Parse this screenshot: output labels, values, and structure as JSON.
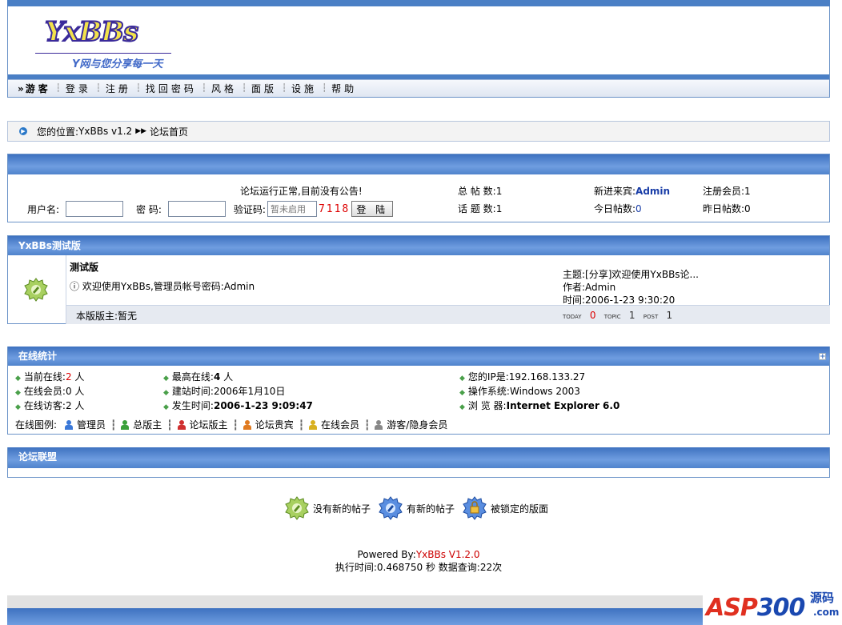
{
  "header": {
    "logo_text": "YxBBs",
    "slogan": "Y网与您分享每一天"
  },
  "nav": {
    "guest": "游客",
    "items": [
      "登录",
      "注册",
      "找回密码",
      "风格",
      "面版",
      "设施",
      "帮助"
    ]
  },
  "breadcrumb": {
    "prefix": "您的位置: ",
    "home": "YxBBs v1.2",
    "current": "论坛首页"
  },
  "login": {
    "notice": "论坛运行正常,目前没有公告!",
    "username_label": "用户名:",
    "password_label": "密 码:",
    "captcha_label": "验证码:",
    "captcha_placeholder": "暂未启用",
    "captcha_code": "7118",
    "login_button": "登 陆"
  },
  "stats": {
    "total_posts_label": "总 帖 数:",
    "total_posts": "1",
    "topics_label": "话 题 数:",
    "topics": "1",
    "newest_member_label": "新进来宾:",
    "newest_member": "Admin",
    "today_posts_label": "今日帖数:",
    "today_posts": "0",
    "registered_label": "注册会员:",
    "registered": "1",
    "yesterday_posts_label": "昨日帖数:",
    "yesterday_posts": "0"
  },
  "forum_section": {
    "title": "YxBBs测试版",
    "forum_name": "测试版",
    "description": "欢迎使用YxBBs,管理员帐号密码:Admin",
    "moderator": "本版版主:暂无",
    "last_topic": "主题:[分享]欢迎使用YxBBs论...",
    "last_author": "作者:Admin",
    "last_time": "时间:2006-1-23 9:30:20",
    "today_label": "TODAY",
    "today_count": "0",
    "topic_label": "TOPIC",
    "topic_count": "1",
    "post_label": "POST",
    "post_count": "1"
  },
  "online": {
    "title": "在线统计",
    "current_online_label": "当前在线:",
    "current_online": "2",
    "online_members_label": "在线会员:",
    "online_members": "0",
    "online_guests_label": "在线访客:",
    "online_guests": "2",
    "unit": " 人",
    "max_online_label": "最高在线:",
    "max_online": "4",
    "site_built_label": "建站时间:",
    "site_built": "2006年1月10日",
    "occurred_label": "发生时间:",
    "occurred": "2006-1-23 9:09:47",
    "ip_label": "您的IP是:",
    "ip": "192.168.133.27",
    "os_label": "操作系统:",
    "os": "Windows 2003",
    "browser_label": "浏 览 器:",
    "browser": "Internet Explorer 6.0",
    "legend_title": "在线图例:",
    "legend": [
      {
        "label": "管理员",
        "color": "#3a78d8"
      },
      {
        "label": "总版主",
        "color": "#3aa03a"
      },
      {
        "label": "论坛版主",
        "color": "#d03030"
      },
      {
        "label": "论坛贵宾",
        "color": "#e07a20"
      },
      {
        "label": "在线会员",
        "color": "#d8b020"
      },
      {
        "label": "游客/隐身会员",
        "color": "#888888"
      }
    ]
  },
  "union": {
    "title": "论坛联盟"
  },
  "icon_legend": {
    "no_new": "没有新的帖子",
    "has_new": "有新的帖子",
    "locked": "被锁定的版面"
  },
  "footer": {
    "powered_prefix": "Powered By:",
    "powered_link": "YxBBs V1.2.0",
    "exec": "执行时间:0.468750 秒 数据查询:22次"
  },
  "watermark": {
    "text_a": "ASP",
    "text_b": "300",
    "cn": "源码",
    "com": ".com"
  }
}
